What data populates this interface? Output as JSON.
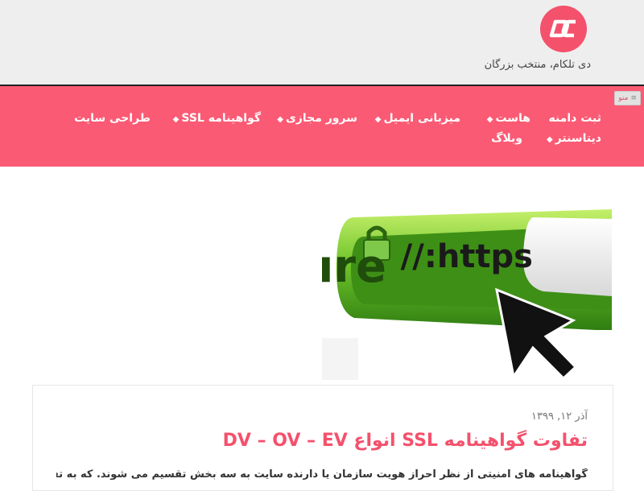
{
  "site": {
    "tagline": "دی تلکام، منتخب بزرگان",
    "brand_color": "#f4516c",
    "nav_color": "#fb5a74"
  },
  "menu_toggle": {
    "label": "منو",
    "icon": "hamburger-icon"
  },
  "nav": {
    "items": [
      {
        "label": "ثبت دامنه",
        "has_dropdown": false
      },
      {
        "label": "هاست",
        "has_dropdown": true
      },
      {
        "label": "میزبانی ایمیل",
        "has_dropdown": true
      },
      {
        "label": "سرور مجازی",
        "has_dropdown": true
      },
      {
        "label": "گواهینامه SSL",
        "has_dropdown": true
      },
      {
        "label": "طراحی سایت",
        "has_dropdown": false
      },
      {
        "label": "دیتاسنتر",
        "has_dropdown": true
      },
      {
        "label": "وبلاگ",
        "has_dropdown": false
      }
    ]
  },
  "hero": {
    "secure_text": "Secure",
    "url_text": "https://"
  },
  "post": {
    "date": "آذر ۱۲, ۱۳۹۹",
    "title": "تفاوت گواهینامه SSL انواع DV – OV – EV",
    "excerpt": "گواهینامه های امنیتی از نظر احراز هویت سازمان یا دارنده سایت به سه بخش تقسیم می شوند. که به تفاوت"
  }
}
